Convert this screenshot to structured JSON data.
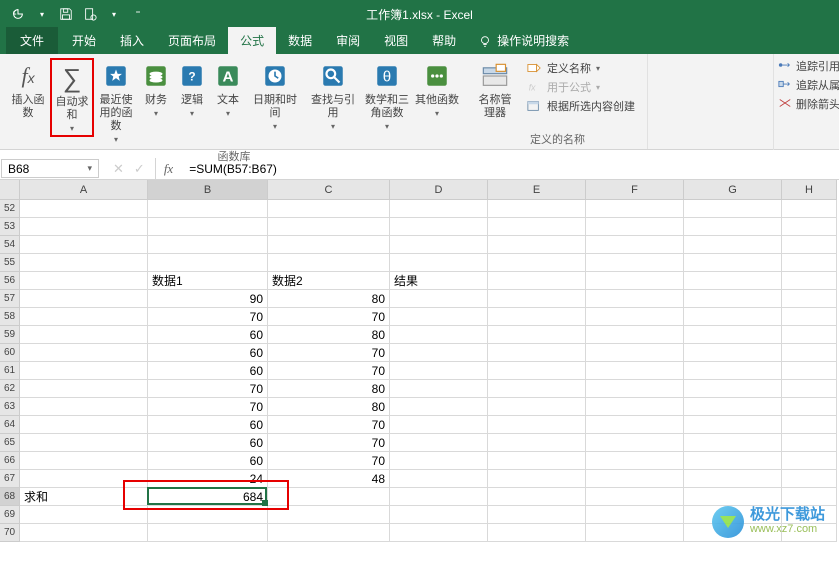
{
  "app": {
    "title": "工作簿1.xlsx  -  Excel"
  },
  "qat": {
    "history_icon": "history-icon",
    "save_icon": "save-icon",
    "touch_icon": "touch-icon",
    "more_icon": "chevron-down-icon"
  },
  "tabs": {
    "file": "文件",
    "home": "开始",
    "insert": "插入",
    "pagelayout": "页面布局",
    "formulas": "公式",
    "data": "数据",
    "review": "审阅",
    "view": "视图",
    "help": "帮助",
    "tellme": "操作说明搜索"
  },
  "ribbon": {
    "insert_fn": "插入函数",
    "autosum": "自动求和",
    "recent": "最近使用的函数",
    "financial": "财务",
    "logical": "逻辑",
    "text": "文本",
    "datetime": "日期和时间",
    "lookup": "查找与引用",
    "math": "数学和三角函数",
    "more_fn": "其他函数",
    "group_fnlib": "函数库",
    "name_mgr": "名称管理器",
    "define_name": "定义名称",
    "use_in_formula": "用于公式",
    "create_from_sel": "根据所选内容创建",
    "group_defined_names": "定义的名称",
    "trace_precedents": "追踪引用",
    "trace_dependents": "追踪从属",
    "remove_arrows": "删除箭头"
  },
  "namebox": {
    "value": "B68"
  },
  "formula_bar": {
    "fx": "fx",
    "value": "=SUM(B57:B67)"
  },
  "sheet": {
    "cols": [
      "A",
      "B",
      "C",
      "D",
      "E",
      "F",
      "G",
      "H"
    ],
    "rows": [
      "52",
      "53",
      "54",
      "55",
      "56",
      "57",
      "58",
      "59",
      "60",
      "61",
      "62",
      "63",
      "64",
      "65",
      "66",
      "67",
      "68",
      "69",
      "70"
    ],
    "headers": {
      "B56": "数据1",
      "C56": "数据2",
      "D56": "结果"
    },
    "A68": "求和",
    "B": {
      "57": "90",
      "58": "70",
      "59": "60",
      "60": "60",
      "61": "60",
      "62": "70",
      "63": "70",
      "64": "60",
      "65": "60",
      "66": "60",
      "67": "24",
      "68": "684"
    },
    "C": {
      "57": "80",
      "58": "70",
      "59": "80",
      "60": "70",
      "61": "70",
      "62": "80",
      "63": "80",
      "64": "70",
      "65": "70",
      "66": "70",
      "67": "48"
    }
  },
  "chart_data": {
    "type": "table",
    "title": "",
    "columns": [
      "数据1",
      "数据2",
      "结果"
    ],
    "rows": [
      [
        90,
        80,
        null
      ],
      [
        70,
        70,
        null
      ],
      [
        60,
        80,
        null
      ],
      [
        60,
        70,
        null
      ],
      [
        60,
        70,
        null
      ],
      [
        70,
        80,
        null
      ],
      [
        70,
        80,
        null
      ],
      [
        60,
        70,
        null
      ],
      [
        60,
        70,
        null
      ],
      [
        60,
        70,
        null
      ],
      [
        24,
        48,
        null
      ]
    ],
    "summary": {
      "label": "求和",
      "数据1": 684
    }
  },
  "watermark": {
    "main": "极光下载站",
    "sub": "www.xz7.com"
  }
}
